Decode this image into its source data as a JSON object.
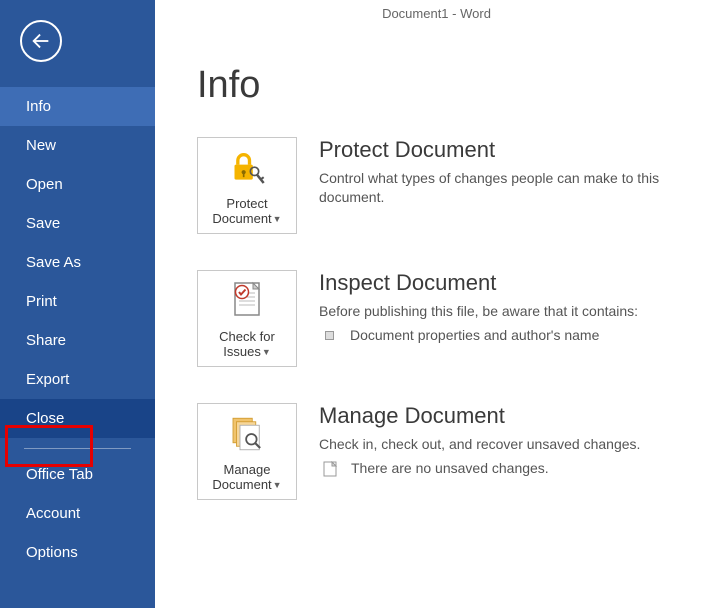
{
  "window_title": "Document1 - Word",
  "page_heading": "Info",
  "nav": {
    "items": [
      {
        "label": "Info",
        "key": "info",
        "active": true
      },
      {
        "label": "New",
        "key": "new"
      },
      {
        "label": "Open",
        "key": "open"
      },
      {
        "label": "Save",
        "key": "save"
      },
      {
        "label": "Save As",
        "key": "save-as"
      },
      {
        "label": "Print",
        "key": "print"
      },
      {
        "label": "Share",
        "key": "share"
      },
      {
        "label": "Export",
        "key": "export"
      },
      {
        "label": "Close",
        "key": "close",
        "highlighted": true
      },
      {
        "label": "Office Tab",
        "key": "office-tab",
        "separator_before": true
      },
      {
        "label": "Account",
        "key": "account"
      },
      {
        "label": "Options",
        "key": "options"
      }
    ]
  },
  "sections": {
    "protect": {
      "tile_label_1": "Protect",
      "tile_label_2": "Document",
      "title": "Protect Document",
      "desc": "Control what types of changes people can make to this document."
    },
    "inspect": {
      "tile_label_1": "Check for",
      "tile_label_2": "Issues",
      "title": "Inspect Document",
      "desc": "Before publishing this file, be aware that it contains:",
      "bullet": "Document properties and author's name"
    },
    "manage": {
      "tile_label_1": "Manage",
      "tile_label_2": "Document",
      "title": "Manage Document",
      "desc": "Check in, check out, and recover unsaved changes.",
      "bullet": "There are no unsaved changes."
    }
  },
  "annotation": {
    "close_highlight_box": true
  }
}
